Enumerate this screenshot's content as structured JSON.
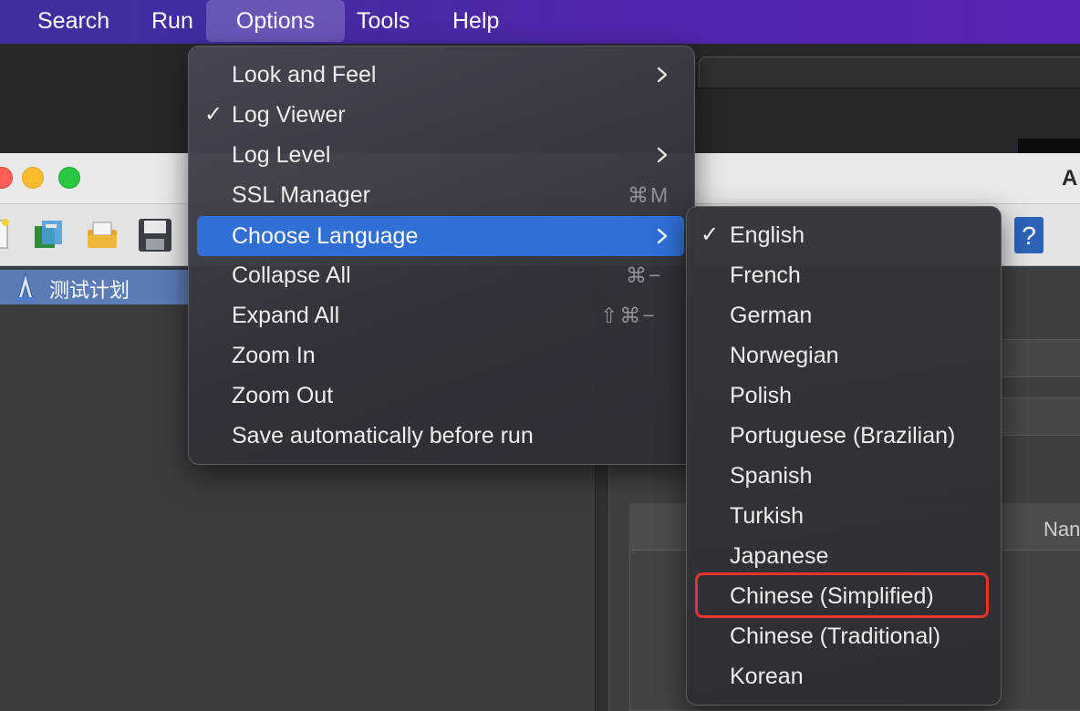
{
  "menubar": {
    "items": [
      {
        "label": "Search"
      },
      {
        "label": "Run"
      },
      {
        "label": "Options"
      },
      {
        "label": "Tools"
      },
      {
        "label": "Help"
      }
    ],
    "active": "Options"
  },
  "window": {
    "title_partial": "A",
    "tree": {
      "selected_node": "测试计划"
    },
    "table": {
      "column_header_partial": "Nan"
    }
  },
  "options_menu": {
    "items": [
      {
        "label": "Look and Feel",
        "submenu": true
      },
      {
        "label": "Log Viewer",
        "checked": true
      },
      {
        "label": "Log Level",
        "submenu": true
      },
      {
        "label": "SSL Manager",
        "shortcut": "⌘M"
      },
      {
        "label": "Choose Language",
        "submenu": true,
        "highlighted": true
      },
      {
        "label": "Collapse All",
        "shortcut": "⌘−"
      },
      {
        "label": "Expand All",
        "shortcut": "⇧⌘−"
      },
      {
        "label": "Zoom In"
      },
      {
        "label": "Zoom Out"
      },
      {
        "label": "Save automatically before run"
      }
    ]
  },
  "language_menu": {
    "check_glyph": "✓",
    "items": [
      {
        "label": "English",
        "checked": true
      },
      {
        "label": "French"
      },
      {
        "label": "German"
      },
      {
        "label": "Norwegian"
      },
      {
        "label": "Polish"
      },
      {
        "label": "Portuguese (Brazilian)"
      },
      {
        "label": "Spanish"
      },
      {
        "label": "Turkish"
      },
      {
        "label": "Japanese"
      },
      {
        "label": "Chinese (Simplified)",
        "annotated": true
      },
      {
        "label": "Chinese (Traditional)"
      },
      {
        "label": "Korean"
      }
    ]
  },
  "colors": {
    "menubar_start": "#3e2f9e",
    "menubar_end": "#5a24b4",
    "menu_highlight": "#2f6fd6",
    "annotation_box": "#e8332a",
    "tree_selection": "#5a7bb5"
  },
  "icons": [
    "new-file-icon",
    "templates-icon",
    "open-folder-icon",
    "save-icon",
    "help-icon",
    "test-plan-icon",
    "chevron-right-icon",
    "checkmark-icon"
  ]
}
